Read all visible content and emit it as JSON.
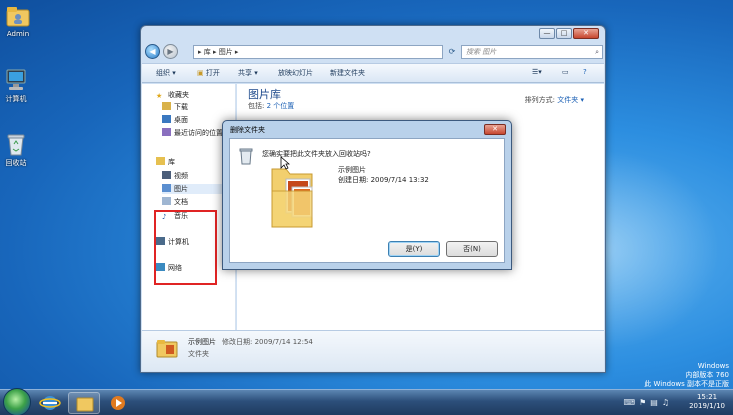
{
  "desktop": {
    "icons": [
      {
        "label": "Admin",
        "icon": "user-folder-icon"
      },
      {
        "label": "计算机",
        "icon": "computer-icon"
      },
      {
        "label": "回收站",
        "icon": "recycle-bin-icon"
      }
    ],
    "watermark": {
      "line1": "Windows",
      "line2": "内部版本 760",
      "line3": "此 Windows 副本不是正版"
    }
  },
  "explorer": {
    "address_path": "▸ 库 ▸ 图片 ▸",
    "search_placeholder": "搜索 图片",
    "window_buttons": {
      "minimize": "—",
      "maximize": "□",
      "close": "✕"
    },
    "toolbar": {
      "organize": "组织 ▾",
      "open": "打开",
      "share": "共享 ▾",
      "slideshow": "放映幻灯片",
      "new_folder": "新建文件夹"
    },
    "nav": {
      "favorites": "收藏夹",
      "downloads": "下载",
      "desktop": "桌面",
      "recent": "最近访问的位置",
      "libraries": "库",
      "videos": "视频",
      "pictures": "图片",
      "documents": "文档",
      "music": "音乐",
      "computer": "计算机",
      "network": "网络"
    },
    "content": {
      "title": "图片库",
      "includes_prefix": "包括:",
      "includes_link": "2 个位置",
      "arrange_label": "排列方式:",
      "arrange_value": "文件夹 ▾"
    },
    "details": {
      "name": "示例图片",
      "modified_label": "修改日期: 2009/7/14 12:54",
      "type": "文件夹"
    }
  },
  "dialog": {
    "title": "删除文件夹",
    "question": "您确实要把此文件夹放入回收站吗?",
    "item_name": "示例图片",
    "item_date": "创建日期: 2009/7/14 13:32",
    "yes": "是(Y)",
    "no": "否(N)",
    "close": "✕"
  },
  "taskbar": {
    "time": "15:21",
    "date": "2019/1/10"
  },
  "colors": {
    "highlight_box": "#e02424",
    "link": "#1a5fb4"
  }
}
